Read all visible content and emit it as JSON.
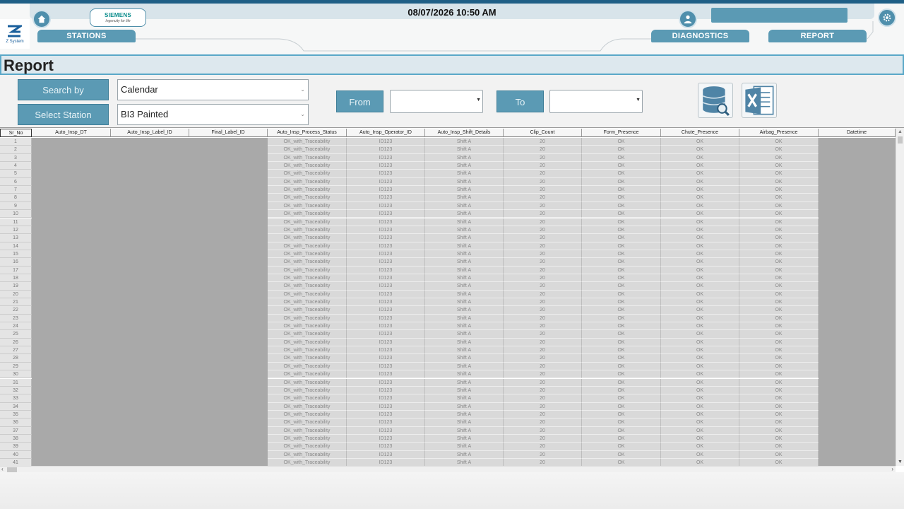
{
  "header": {
    "datetime": "08/07/2026 10:50 AM",
    "brand_logo": "SIEMENS",
    "brand_tagline": "Ingenuity for life",
    "company_label": "Z System",
    "home_icon": "home-icon",
    "user_icon": "user-icon",
    "settings_icon": "gear-icon",
    "nav": {
      "stations": "STATIONS",
      "diagnostics": "DIAGNOSTICS",
      "report": "REPORT"
    }
  },
  "page": {
    "title": "Report"
  },
  "filters": {
    "search_by_label": "Search by",
    "search_by_value": "Calendar",
    "select_station_label": "Select Station",
    "select_station_value": "BI3 Painted",
    "from_label": "From",
    "from_value": "",
    "to_label": "To",
    "to_value": "",
    "search_db_icon": "database-search-icon",
    "export_icon": "excel-export-icon"
  },
  "colors": {
    "accent": "#5b9ab4",
    "top_line": "#1f5f86",
    "title_border": "#5aa8c8"
  },
  "table": {
    "columns": [
      "Sr_No",
      "Auto_Insp_DT",
      "Auto_Insp_Label_ID",
      "Final_Label_ID",
      "Auto_Insp_Process_Status",
      "Auto_Insp_Operator_ID",
      "Auto_Insp_Shift_Details",
      "Clip_Count",
      "Form_Presence",
      "Chute_Presence",
      "Airbag_Presence",
      "Datetime"
    ],
    "row_template": {
      "Auto_Insp_DT": "",
      "Auto_Insp_Label_ID": "",
      "Final_Label_ID": "",
      "Auto_Insp_Process_Status": "OK_with_Traceability",
      "Auto_Insp_Operator_ID": "ID123",
      "Auto_Insp_Shift_Details": "Shift A",
      "Clip_Count": "20",
      "Form_Presence": "OK",
      "Chute_Presence": "OK",
      "Airbag_Presence": "OK",
      "Datetime": ""
    },
    "row_count": 41
  }
}
